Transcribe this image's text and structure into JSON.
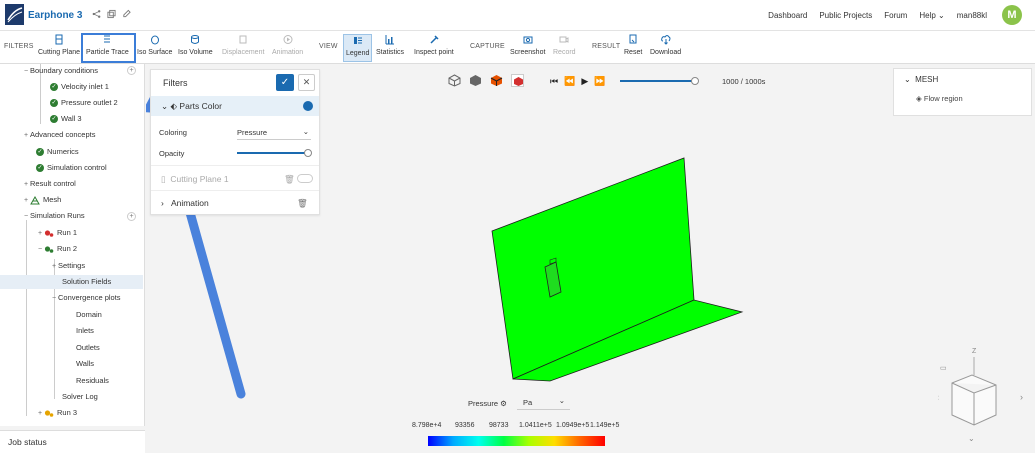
{
  "app": {
    "project_title": "Earphone 3",
    "nav": [
      "Dashboard",
      "Public Projects",
      "Forum",
      "Help ⌄",
      "man88kl"
    ],
    "avatar_initial": "M",
    "accent": "#1a6ab0"
  },
  "toolbar": {
    "filters_label": "FILTERS",
    "view_label": "VIEW",
    "capture_label": "CAPTURE",
    "result_label": "RESULT",
    "items": {
      "cutting_plane": "Cutting Plane",
      "particle_trace": "Particle Trace",
      "iso_surface": "Iso Surface",
      "iso_volume": "Iso Volume",
      "displacement": "Displacement",
      "animation": "Animation",
      "legend": "Legend",
      "statistics": "Statistics",
      "inspect_point": "Inspect point",
      "screenshot": "Screenshot",
      "record": "Record",
      "reset": "Reset",
      "download": "Download"
    }
  },
  "tree": {
    "boundary_conditions": "Boundary conditions",
    "velocity_inlet": "Velocity inlet 1",
    "pressure_outlet": "Pressure outlet 2",
    "wall": "Wall 3",
    "advanced_concepts": "Advanced concepts",
    "numerics": "Numerics",
    "simulation_control": "Simulation control",
    "result_control": "Result control",
    "mesh": "Mesh",
    "simulation_runs": "Simulation Runs",
    "run1": "Run 1",
    "run2": "Run 2",
    "settings": "Settings",
    "solution_fields": "Solution Fields",
    "convergence_plots": "Convergence plots",
    "domain": "Domain",
    "inlets": "Inlets",
    "outlets": "Outlets",
    "walls": "Walls",
    "residuals": "Residuals",
    "solver_log": "Solver Log",
    "run3": "Run 3",
    "job_status": "Job status"
  },
  "filters_panel": {
    "title": "Filters",
    "parts_color": "Parts Color",
    "coloring_label": "Coloring",
    "coloring_value": "Pressure",
    "opacity_label": "Opacity",
    "opacity_level": 1.0,
    "cutting_plane": "Cutting Plane 1",
    "animation": "Animation"
  },
  "viewer": {
    "frame_counter": "1000 / 1000s",
    "playback_progress": 1.0,
    "mesh_panel_title": "MESH",
    "mesh_item": "Flow region",
    "legend_quantity": "Pressure",
    "legend_unit": "Pa",
    "legend_ticks": [
      "8.798e+4",
      "93356",
      "98733",
      "1.0411e+5",
      "1.0949e+5",
      "1.149e+5"
    ],
    "model_color": "#00ff00"
  }
}
